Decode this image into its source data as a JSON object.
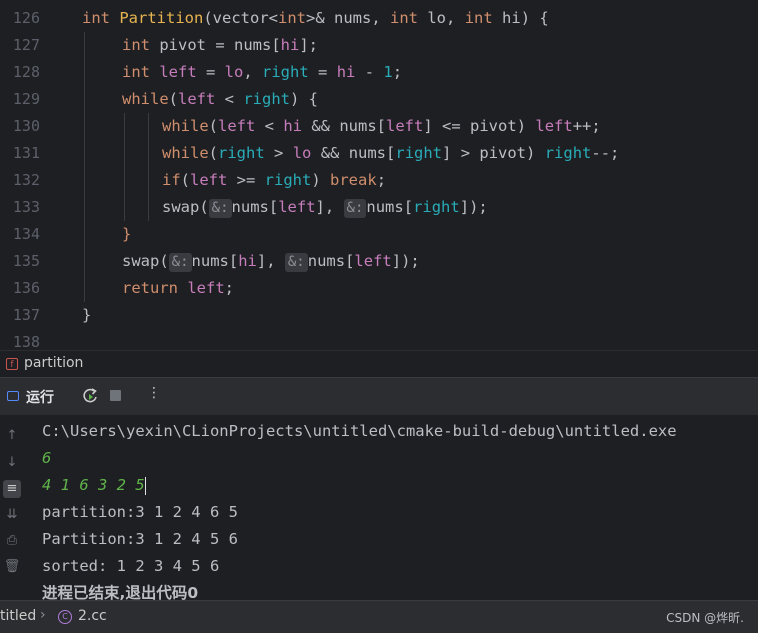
{
  "editor": {
    "line_numbers": [
      "126",
      "127",
      "128",
      "129",
      "130",
      "131",
      "132",
      "133",
      "134",
      "135",
      "136",
      "137",
      "138"
    ],
    "lines": {
      "l126": {
        "t1": "int",
        "t2": "Partition",
        "t3": "(vector<",
        "t4": "int",
        ">": ">",
        "t5": "& ",
        "t6": "nums",
        ",": ", ",
        "t7": "int",
        "t8": " lo",
        ",2": ", ",
        "t9": "int",
        "t10": " hi",
        ") {": ") {"
      },
      "l127": {
        "a": "int",
        "b": " pivot = ",
        "c": "nums",
        "d": "[",
        "e": "hi",
        "f": "];"
      },
      "l128": {
        "a": "int",
        "b": " left",
        "c": " = ",
        "d": "lo",
        ",": ", ",
        "e": "right",
        "f": " = ",
        "g": "hi",
        "h": " - ",
        "i": "1",
        ";": ";"
      },
      "l129": {
        "a": "while",
        "b": "(",
        "c": "left",
        "d": " < ",
        "e": "right",
        "f": ") {"
      },
      "l130": {
        "a": "while",
        "b": "(",
        "c": "left",
        "d": " < ",
        "e": "hi",
        "f": " && ",
        "g": "nums",
        "h": "[",
        "i": "left",
        "j": "] <= ",
        "k": "pivot",
        "l": ") ",
        "m": "left",
        "n": "++;"
      },
      "l131": {
        "a": "while",
        "b": "(",
        "c": "right",
        "d": " > ",
        "e": "lo",
        "f": " && ",
        "g": "nums",
        "h": "[",
        "i": "right",
        "j": "] > ",
        "k": "pivot",
        "l": ") ",
        "m": "right",
        "n": "--;"
      },
      "l132": {
        "a": "if",
        "b": "(",
        "c": "left",
        "d": " >= ",
        "e": "right",
        "f": ") ",
        "g": "break",
        ";": ";"
      },
      "l133": {
        "a": "swap",
        "b": "(",
        "h1": "&:",
        "c": "nums",
        "d": "[",
        "e": "left",
        "f": "], ",
        "h2": "&:",
        "g": "nums",
        "h": "[",
        "i": "right",
        "j": "]);"
      },
      "l134": {
        "a": "}"
      },
      "l135": {
        "a": "swap",
        "b": "(",
        "h1": "&:",
        "c": "nums",
        "d": "[",
        "e": "hi",
        "f": "], ",
        "h2": "&:",
        "g": "nums",
        "h": "[",
        "i": "left",
        "j": "]);"
      },
      "l136": {
        "a": "return",
        "b": " left",
        ";": ";"
      },
      "l137": {
        "a": "}"
      }
    }
  },
  "breadcrumb": {
    "badge": "f",
    "label": "partition"
  },
  "toolbar": {
    "run_label": "运行",
    "more": "⋮"
  },
  "console": {
    "sidebar_icons": [
      "arrow-up-icon",
      "arrow-down-icon",
      "soft-wrap-icon",
      "scroll-to-end-icon",
      "print-icon",
      "trash-icon"
    ],
    "lines": [
      {
        "text": "C:\\Users\\yexin\\CLionProjects\\untitled\\cmake-build-debug\\untitled.exe",
        "kind": "path"
      },
      {
        "text": "6",
        "kind": "input"
      },
      {
        "text": "4 1 6 3 2 5",
        "kind": "input"
      },
      {
        "text": "partition:3 1 2 4 6 5",
        "kind": "out"
      },
      {
        "text": "Partition:3 1 2 4 5 6",
        "kind": "out"
      },
      {
        "text": "sorted: 1 2 3 4 5 6",
        "kind": "out"
      },
      {
        "text": "进程已结束,退出代码0",
        "kind": "bold"
      }
    ]
  },
  "status": {
    "project": "titled",
    "sep": "›",
    "file_icon": "C",
    "file": "2.cc",
    "watermark": "CSDN @烨昕."
  },
  "colors": {
    "background": "#1e1f22",
    "keyword": "#cf8e6d",
    "function": "#56a8f5",
    "member": "#c77dbb",
    "input_text": "#5fb34a",
    "accent": "#548af7"
  }
}
